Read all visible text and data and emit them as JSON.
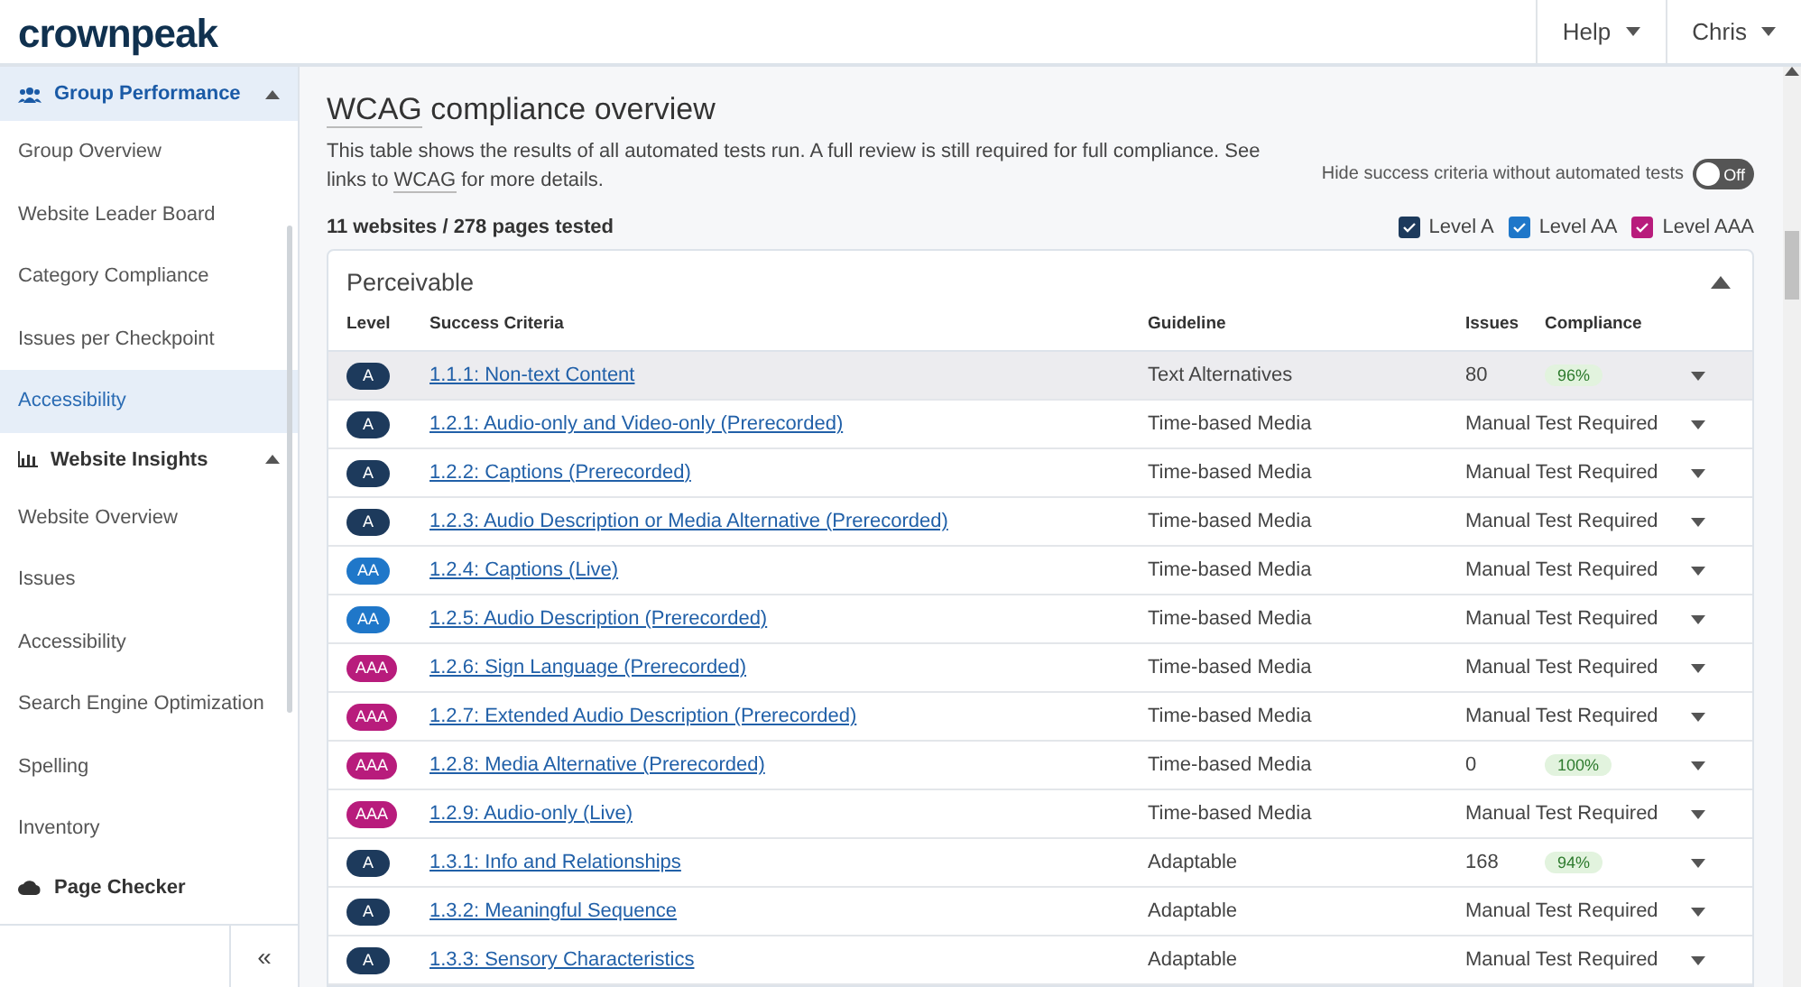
{
  "header": {
    "logo": "crownpeak",
    "menus": [
      {
        "label": "Help"
      },
      {
        "label": "Chris"
      }
    ]
  },
  "sidebar": {
    "sections": [
      {
        "title": "Group Performance",
        "expanded": true,
        "selected": true,
        "items": [
          {
            "label": "Group Overview",
            "selected": false
          },
          {
            "label": "Website Leader Board",
            "selected": false
          },
          {
            "label": "Category Compliance",
            "selected": false
          },
          {
            "label": "Issues per Checkpoint",
            "selected": false
          },
          {
            "label": "Accessibility",
            "selected": true
          }
        ]
      },
      {
        "title": "Website Insights",
        "expanded": true,
        "selected": false,
        "items": [
          {
            "label": "Website Overview",
            "selected": false
          },
          {
            "label": "Issues",
            "selected": false
          },
          {
            "label": "Accessibility",
            "selected": false
          },
          {
            "label": "Search Engine Optimization",
            "selected": false
          },
          {
            "label": "Spelling",
            "selected": false
          },
          {
            "label": "Inventory",
            "selected": false
          }
        ]
      },
      {
        "title": "Page Checker",
        "expanded": false,
        "selected": false
      }
    ],
    "collapse": "«"
  },
  "main": {
    "title_parts": [
      "WCAG",
      " compliance overview"
    ],
    "description": [
      "This table shows the results of all automated tests run. A full review is still required for full compliance. See links to ",
      "WCAG",
      " for more details."
    ],
    "summary": "11 websites / 278 pages tested",
    "toggle": {
      "label": "Hide success criteria without automated tests",
      "on": false,
      "state_text": "Off"
    },
    "filters": [
      {
        "label": "Level A",
        "checked": true,
        "color": "#1d3a5c"
      },
      {
        "label": "Level AA",
        "checked": true,
        "color": "#1f77c9"
      },
      {
        "label": "Level AAA",
        "checked": true,
        "color": "#b81c7c"
      }
    ],
    "panel": {
      "title": "Perceivable",
      "expanded": true,
      "columns": [
        "Level",
        "Success Criteria",
        "Guideline",
        "Issues",
        "Compliance"
      ],
      "rows": [
        {
          "level": "A",
          "color": "#1d3a5c",
          "criteria": "1.1.1: Non-text Content",
          "guideline": "Text Alternatives",
          "issues": "80",
          "compliance": "96%",
          "selected": true
        },
        {
          "level": "A",
          "color": "#1d3a5c",
          "criteria": "1.2.1: Audio-only and Video-only (Prerecorded)",
          "guideline": "Time-based Media",
          "issues": "Manual Test Required",
          "selected": false
        },
        {
          "level": "A",
          "color": "#1d3a5c",
          "criteria": "1.2.2: Captions (Prerecorded)",
          "guideline": "Time-based Media",
          "issues": "Manual Test Required",
          "selected": false
        },
        {
          "level": "A",
          "color": "#1d3a5c",
          "criteria": "1.2.3: Audio Description or Media Alternative (Prerecorded)",
          "guideline": "Time-based Media",
          "issues": "Manual Test Required",
          "selected": false
        },
        {
          "level": "AA",
          "color": "#1f77c9",
          "criteria": "1.2.4: Captions (Live)",
          "guideline": "Time-based Media",
          "issues": "Manual Test Required",
          "selected": false
        },
        {
          "level": "AA",
          "color": "#1f77c9",
          "criteria": "1.2.5: Audio Description (Prerecorded)",
          "guideline": "Time-based Media",
          "issues": "Manual Test Required",
          "selected": false
        },
        {
          "level": "AAA",
          "color": "#b81c7c",
          "criteria": "1.2.6: Sign Language (Prerecorded)",
          "guideline": "Time-based Media",
          "issues": "Manual Test Required",
          "selected": false
        },
        {
          "level": "AAA",
          "color": "#b81c7c",
          "criteria": "1.2.7: Extended Audio Description (Prerecorded)",
          "guideline": "Time-based Media",
          "issues": "Manual Test Required",
          "selected": false
        },
        {
          "level": "AAA",
          "color": "#b81c7c",
          "criteria": "1.2.8: Media Alternative (Prerecorded)",
          "guideline": "Time-based Media",
          "issues": "0",
          "compliance": "100%",
          "selected": false
        },
        {
          "level": "AAA",
          "color": "#b81c7c",
          "criteria": "1.2.9: Audio-only (Live)",
          "guideline": "Time-based Media",
          "issues": "Manual Test Required",
          "selected": false
        },
        {
          "level": "A",
          "color": "#1d3a5c",
          "criteria": "1.3.1: Info and Relationships",
          "guideline": "Adaptable",
          "issues": "168",
          "compliance": "94%",
          "selected": false
        },
        {
          "level": "A",
          "color": "#1d3a5c",
          "criteria": "1.3.2: Meaningful Sequence",
          "guideline": "Adaptable",
          "issues": "Manual Test Required",
          "selected": false
        },
        {
          "level": "A",
          "color": "#1d3a5c",
          "criteria": "1.3.3: Sensory Characteristics",
          "guideline": "Adaptable",
          "issues": "Manual Test Required",
          "selected": false
        }
      ]
    }
  }
}
